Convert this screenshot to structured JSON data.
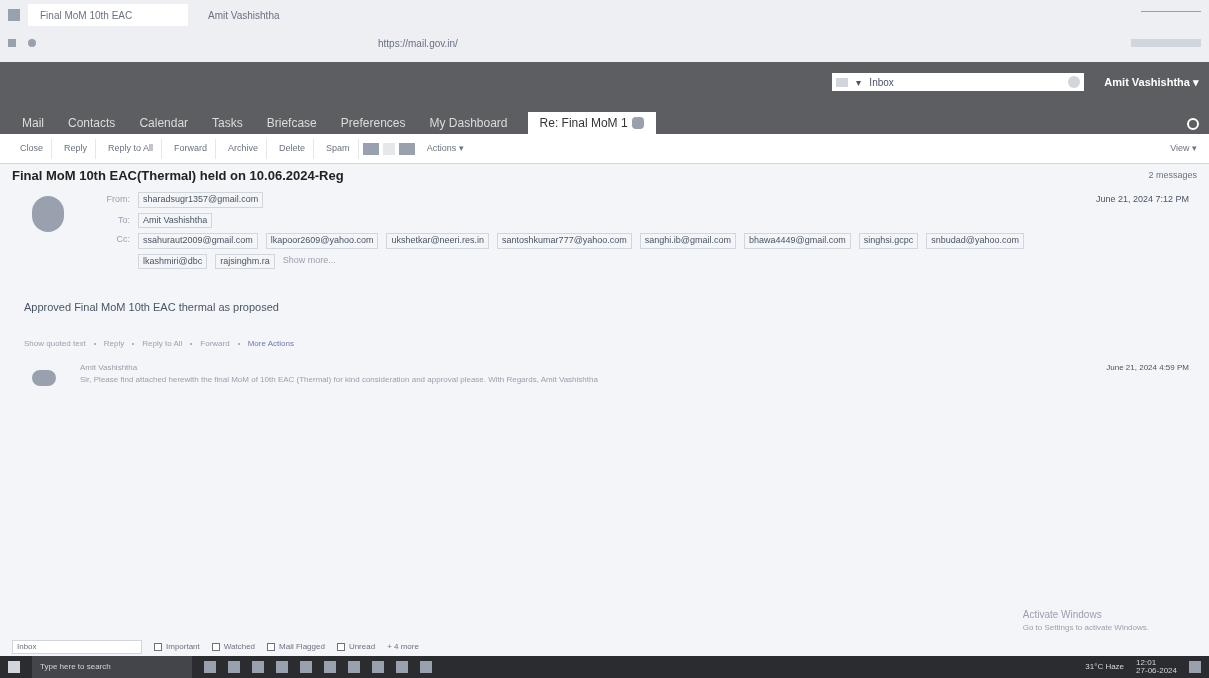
{
  "browser": {
    "tabs": [
      {
        "label": "Final MoM 10th EAC",
        "selected": true
      },
      {
        "label": "Amit Vashishtha",
        "selected": false
      }
    ],
    "address": "https://mail.gov.in/"
  },
  "header": {
    "search": {
      "scope": "▾",
      "value": "Inbox"
    },
    "user": "Amit Vashishtha ▾"
  },
  "nav": [
    {
      "label": "Mail",
      "selected": false
    },
    {
      "label": "Contacts",
      "selected": false
    },
    {
      "label": "Calendar",
      "selected": false
    },
    {
      "label": "Tasks",
      "selected": false
    },
    {
      "label": "Briefcase",
      "selected": false
    },
    {
      "label": "Preferences",
      "selected": false
    },
    {
      "label": "My Dashboard",
      "selected": false
    },
    {
      "label": "Re: Final MoM 1",
      "selected": true
    }
  ],
  "toolbar": {
    "buttons": [
      "Close",
      "Reply",
      "Reply to All",
      "Forward",
      "Archive",
      "Delete",
      "Spam"
    ],
    "actions": "Actions ▾",
    "view": "View ▾"
  },
  "subject": "Final MoM 10th EAC(Thermal) held on 10.06.2024-Reg",
  "count": "2 messages",
  "message": {
    "from_label": "From:",
    "from": "sharadsugr1357@gmail.com",
    "to_label": "To:",
    "to": "Amit Vashishtha",
    "cc_label": "Cc:",
    "cc": [
      "ssahuraut2009@gmail.com",
      "lkapoor2609@yahoo.com",
      "ukshetkar@neeri.res.in",
      "santoshkumar777@yahoo.com",
      "sanghi.ib@gmail.com",
      "bhawa4449@gmail.com",
      "singhsi.gcpc",
      "snbudad@yahoo.com",
      "lkashmiri@dbc",
      "rajsinghm.ra"
    ],
    "show_more": "Show more...",
    "date": "June 21, 2024 7:12 PM",
    "body": "Approved Final MoM 10th EAC thermal as proposed",
    "links": [
      "Show quoted text",
      "Reply",
      "Reply to All",
      "Forward",
      "More Actions"
    ]
  },
  "message2": {
    "sender": "Amit Vashishtha",
    "snippet": "Sir, Please find attached herewith the final MoM of 10th EAC (Thermal) for kind consideration and approval please. With Regards, Amit Vashishtha",
    "date": "June 21, 2024 4:59 PM"
  },
  "footer": {
    "field": "Inbox",
    "checks": [
      {
        "label": "Important",
        "checked": false
      },
      {
        "label": "Watched",
        "checked": false
      },
      {
        "label": "Mail Flagged",
        "checked": false
      },
      {
        "label": "Unread",
        "checked": false
      }
    ],
    "more": "+ 4 more"
  },
  "activation": {
    "title": "Activate Windows",
    "text": "Go to Settings to activate Windows."
  },
  "taskbar": {
    "search": "Type here to search",
    "weather": "31°C Haze",
    "time": "12:01",
    "date": "27-06-2024"
  }
}
